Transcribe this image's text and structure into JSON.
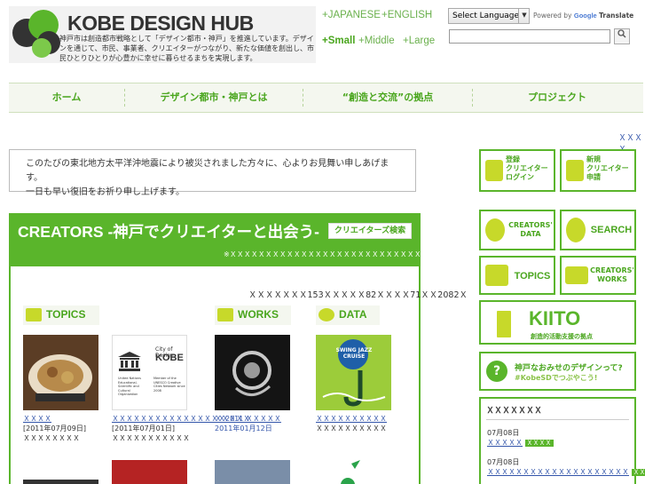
{
  "header": {
    "logo_title_kobe": "KOBE",
    "logo_title_rest": " DESIGN HUB",
    "logo_desc": "神戸市は創造都市戦略として「デザイン都市・神戸」を推進しています。デザインを通じて、市民、事業者、クリエイターがつながり、新たな価値を創出し、市民ひとりひとりが心豊かに幸せに暮らせるまちを実現します。",
    "lang_japanese": "+JAPANESE",
    "lang_english": "+ENGLISH",
    "size_small": "+Small",
    "size_middle": "+Middle",
    "size_large": "+Large",
    "translate_select": "Select Language",
    "translate_powered": "Powered by",
    "translate_google": "Google",
    "translate_word": "Translate"
  },
  "nav": {
    "items": [
      "ホーム",
      "デザイン都市・神戸とは",
      "“創造と交流”の拠点",
      "プロジェクト"
    ]
  },
  "small_link": "ＸＸＸＸ",
  "notice": {
    "line1": "このたびの東北地方太平洋沖地震により被災されました方々に、心よりお見舞い申しあげます。",
    "line2": "一日も早い復旧をお祈り申し上げます。"
  },
  "creators": {
    "title": "CREATORS -神戸でクリエイターと出会う-",
    "search_button": "クリエイターズ検索",
    "subtitle": "※ＸＸＸＸＸＸＸＸＸＸＸＸＸＸＸＸＸＸＸＸＸＸＸＸＸＸＸＸＸＸＸＸＸＸＸＸ",
    "counts": "ＸＸＸＸＸＸＸ153ＸＸＸＸＸ82ＸＸＸＸ71ＸＸ2082Ｘ",
    "cat_topics": "TOPICS",
    "cat_works": "WORKS",
    "cat_data": "DATA",
    "topics_items": [
      {
        "title": "ＸＸＸＸ",
        "date": "[2011年07月09日]",
        "extra": "ＸＸＸＸＸＸＸＸ"
      },
      {
        "title": "ＸＸＸＸＸＸＸＸＸＸＸＸＸＸＸＸ2011 ＸＸＸＸＸ",
        "date": "[2011年07月01日]",
        "extra": "ＸＸＸＸＸＸＸＸＸＸＸ"
      }
    ],
    "works_items": [
      {
        "title": "ＸＸＸＸＸ",
        "date": "2011年01月12日"
      }
    ],
    "data_items": [
      {
        "title": "ＸＸＸＸＸＸＸＸＸＸ",
        "extra": "ＸＸＸＸＸＸＸＸＸＸ"
      }
    ],
    "unesco_text1": "City of Design",
    "unesco_text2": "KOBE",
    "unesco_text3": "United Nations Educational, Scientific and Cultural Organization",
    "unesco_text4": "Member of the UNESCO Creative Cities Network since 2008",
    "jazz_text": "SWING JAZZ CRUISE"
  },
  "sidebar": {
    "register_label": "登録\nクリエイター\nログイン",
    "new_label": "新規\nクリエイター\n申請",
    "creators_data": "CREATORS'\nDATA",
    "search": "SEARCH",
    "topics": "TOPICS",
    "creators_works": "CREATORS'\nWORKS",
    "kiito": "KIITO",
    "kiito_sub": "創造的活動支援の拠点",
    "kobesd_line1": "神戸なおみせのデザインって?",
    "kobesd_line2": "#KobeSDでつぶやこう!",
    "latest_head": "ＸＸＸＸＸＸＸ",
    "news": [
      {
        "date": "07月08日",
        "title": "ＸＸＸＸＸ",
        "tag": "ＸＸＸＸ"
      },
      {
        "date": "07月08日",
        "title": "ＸＸＸＸＸＸＸＸＸＸＸＸＸＸＸＸＸＸＸＸ",
        "tag": "ＸＸＸＸＸ"
      }
    ]
  },
  "colors": {
    "brand_green": "#5ab52b",
    "accent_yellow_green": "#c7d92a",
    "link_blue": "#3355aa"
  }
}
